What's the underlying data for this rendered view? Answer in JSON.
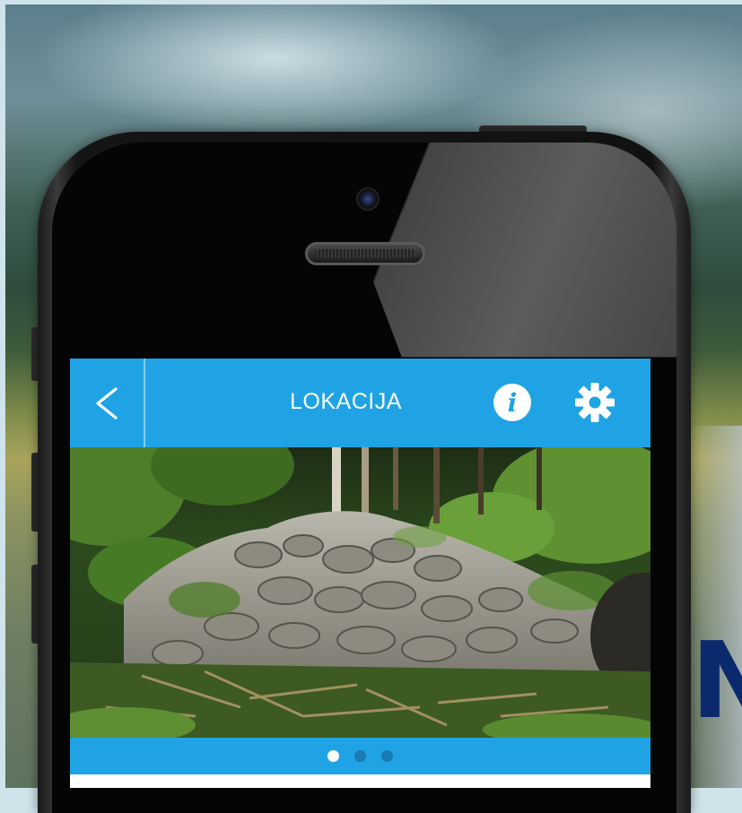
{
  "navbar": {
    "back_label": "<",
    "title": "LOKACIJA",
    "info_label": "i"
  },
  "icons": {
    "back": "chevron-left-icon",
    "info": "info-icon",
    "settings": "gear-icon"
  },
  "carousel": {
    "page_count": 3,
    "active_index": 0
  },
  "overlay": {
    "brand_letter": "N"
  },
  "colors": {
    "accent": "#1fa3e4",
    "frame": "#cfe3ea",
    "brand_text": "#0b2a6e"
  }
}
